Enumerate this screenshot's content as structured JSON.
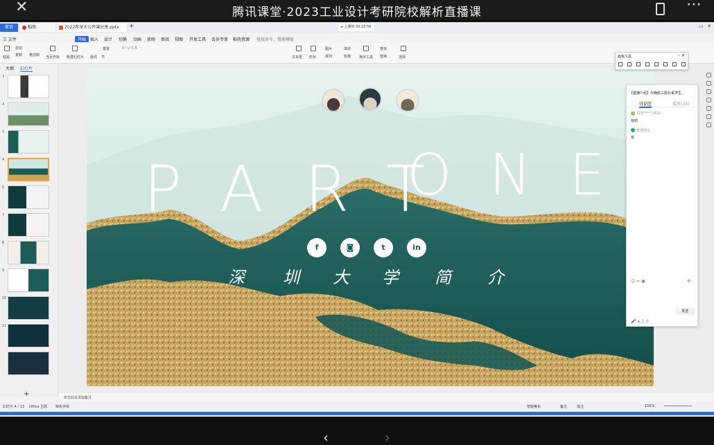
{
  "player": {
    "title": "腾讯课堂·2023工业设计考研院校解析直播课",
    "close": "✕",
    "more": "⋯",
    "prev": "‹",
    "next": "›"
  },
  "wps": {
    "tabs": {
      "home": "首页",
      "tab1": "稻壳",
      "tab2": "2022年深大公开课分享.pptx",
      "add": "+"
    },
    "timer": "▸ 上课中 00:15:56",
    "menu": {
      "file": "三 文件",
      "start": "开始",
      "insert": "插入",
      "design": "设计",
      "switch": "切换",
      "animation": "动画",
      "show": "放映",
      "review": "审阅",
      "view": "视图",
      "dev": "开发工具",
      "member": "会员专享",
      "template": "稻壳资源",
      "search": "查找命令、搜索模板"
    },
    "ribbon": {
      "paste": "粘贴",
      "cut": "剪切",
      "copy": "复制",
      "format": "格式刷",
      "fromcur": "当页开始",
      "newslide": "新建幻灯片",
      "layout": "版式",
      "section": "节",
      "reset": "重置",
      "textbox": "文本框",
      "shape": "形状",
      "arrange": "排列",
      "picture": "图片",
      "fill": "填充",
      "outline": "轮廓",
      "find": "查找",
      "replace": "替换",
      "select": "选择",
      "presenter": "演示工具"
    },
    "left": {
      "outline": "大纲",
      "slides": "幻灯片",
      "nums": [
        "3",
        "4",
        "5",
        "6",
        "7",
        "8",
        "9",
        "10",
        "11"
      ],
      "add": "+"
    },
    "notes": "单击此处添加备注",
    "status": {
      "slide": "幻灯片 4 / 13",
      "theme": "Office 主题",
      "font": "缺失字体",
      "smart": "智能美化",
      "notes": "备注",
      "comment": "批注",
      "zoom": "156%"
    }
  },
  "slide": {
    "part": "PART",
    "one": "ONE",
    "cn": [
      "深",
      "圳",
      "大",
      "学",
      "简",
      "介"
    ],
    "social": [
      "f",
      "◙",
      "t",
      "in"
    ],
    "colors": {
      "teal": "#1d5d58",
      "gold": "#c9a55a",
      "sky": "#cfe6e1"
    }
  },
  "drawtool": {
    "title": "画板工具"
  },
  "chat": {
    "title": "【直播介绍】今晚航三院长系学生...",
    "tab_discuss": "讨论区",
    "tab_members": "成员(18)",
    "msg1_name": "178*****1829",
    "msg1_text": "有的",
    "msg2_name": "李佳轻言",
    "msg2_text": "有",
    "send": "发送"
  }
}
